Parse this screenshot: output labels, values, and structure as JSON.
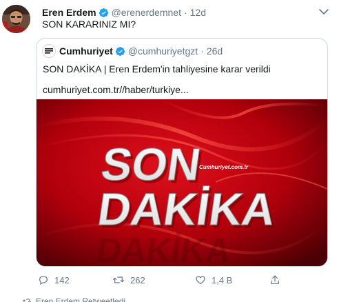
{
  "tweet": {
    "display_name": "Eren Erdem",
    "handle": "@erenerdemnet",
    "separator": "·",
    "time": "12d",
    "text": "SON KARARINIZ MI?"
  },
  "quote": {
    "display_name": "Cumhuriyet",
    "handle": "@cumhuriyetgzt",
    "separator": "·",
    "time": "26d",
    "text": "SON DAKİKA | Eren Erdem'in tahliyesine karar verildi",
    "link": "cumhuriyet.com.tr//haber/turkiye...",
    "media": {
      "headline_top": "SON",
      "headline_bottom": "DAKİKA",
      "watermark": "Cumhuriyet.com.tr"
    }
  },
  "actions": {
    "reply_count": "142",
    "retweet_count": "262",
    "like_count": "1,4 B"
  },
  "footer": {
    "context_text": "Eren Erdem Retweetledi"
  },
  "colors": {
    "verified": "#1da1f2",
    "secondary_text": "#657786",
    "border": "#ccd6dd",
    "media_red": "#c4000f"
  }
}
